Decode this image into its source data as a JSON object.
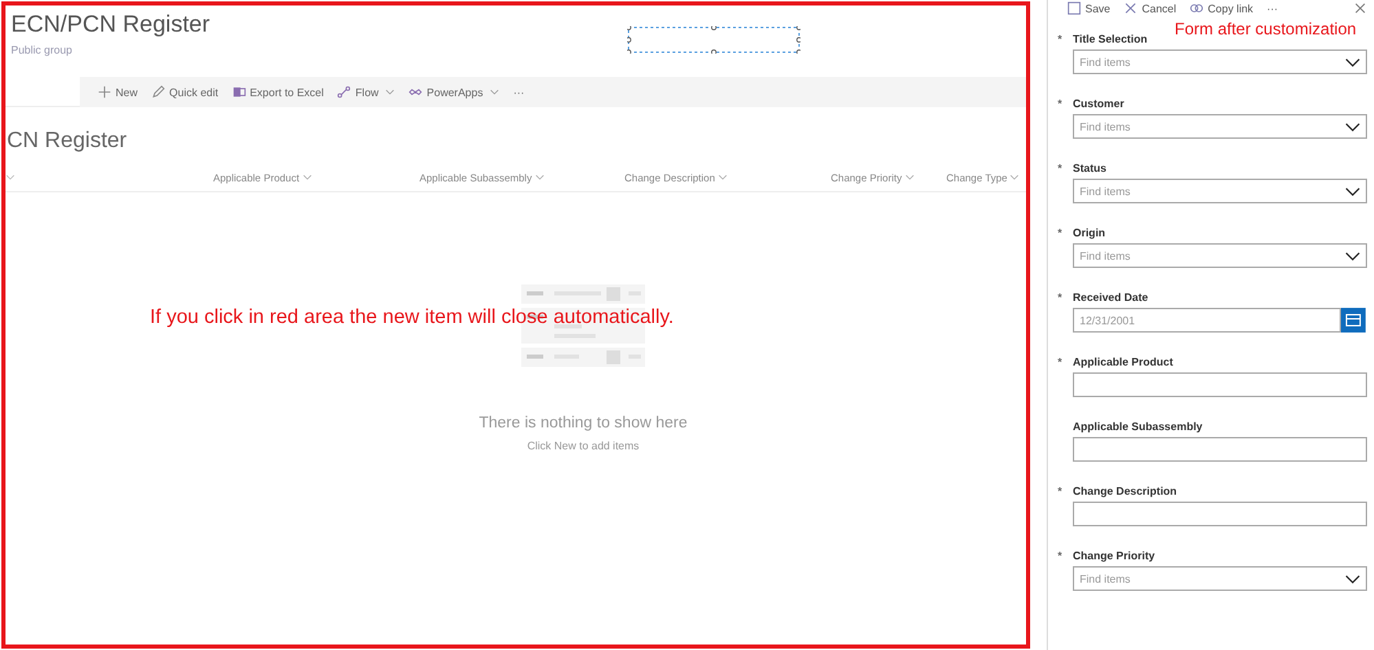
{
  "site": {
    "title": "ECN/PCN Register",
    "subtitle": "Public group"
  },
  "command_bar": [
    {
      "kind": "new",
      "label": "New",
      "menu": false
    },
    {
      "kind": "edit",
      "label": "Quick edit",
      "menu": false
    },
    {
      "kind": "excel",
      "label": "Export to Excel",
      "menu": false
    },
    {
      "kind": "flow",
      "label": "Flow",
      "menu": true
    },
    {
      "kind": "powerapps",
      "label": "PowerApps",
      "menu": true
    },
    {
      "kind": "more",
      "label": "···",
      "menu": false
    }
  ],
  "list_title": "CN Register",
  "columns": [
    "Applicable Product",
    "Applicable Subassembly",
    "Change Description",
    "Change Priority",
    "Change Type"
  ],
  "empty_state": {
    "title": "There is nothing to show here",
    "hint": "Click New to add items"
  },
  "annotations": [
    "If you click in red area the new item will close automatically.",
    "Form after customization"
  ],
  "panel_toolbar": [
    {
      "kind": "save",
      "label": "Save"
    },
    {
      "kind": "cancel",
      "label": "Cancel"
    },
    {
      "kind": "link",
      "label": "Copy link"
    },
    {
      "kind": "more",
      "label": "···"
    }
  ],
  "fields": [
    {
      "kind": "dropdown",
      "label": "Title Selection",
      "required_mark": "*",
      "placeholder": "Find items"
    },
    {
      "kind": "dropdown",
      "label": "Customer",
      "required_mark": "*",
      "placeholder": "Find items"
    },
    {
      "kind": "dropdown",
      "label": "Status",
      "required_mark": "*",
      "placeholder": "Find items"
    },
    {
      "kind": "dropdown",
      "label": "Origin",
      "required_mark": "*",
      "placeholder": "Find items"
    },
    {
      "kind": "date",
      "label": "Received Date",
      "required_mark": "*",
      "value": "12/31/2001"
    },
    {
      "kind": "text",
      "label": "Applicable Product",
      "required_mark": "*"
    },
    {
      "kind": "text",
      "label": "Applicable Subassembly"
    },
    {
      "kind": "text",
      "label": "Change Description",
      "required_mark": "*"
    },
    {
      "kind": "dropdown",
      "label": "Change Priority",
      "required_mark": "*",
      "placeholder": "Find items"
    }
  ]
}
